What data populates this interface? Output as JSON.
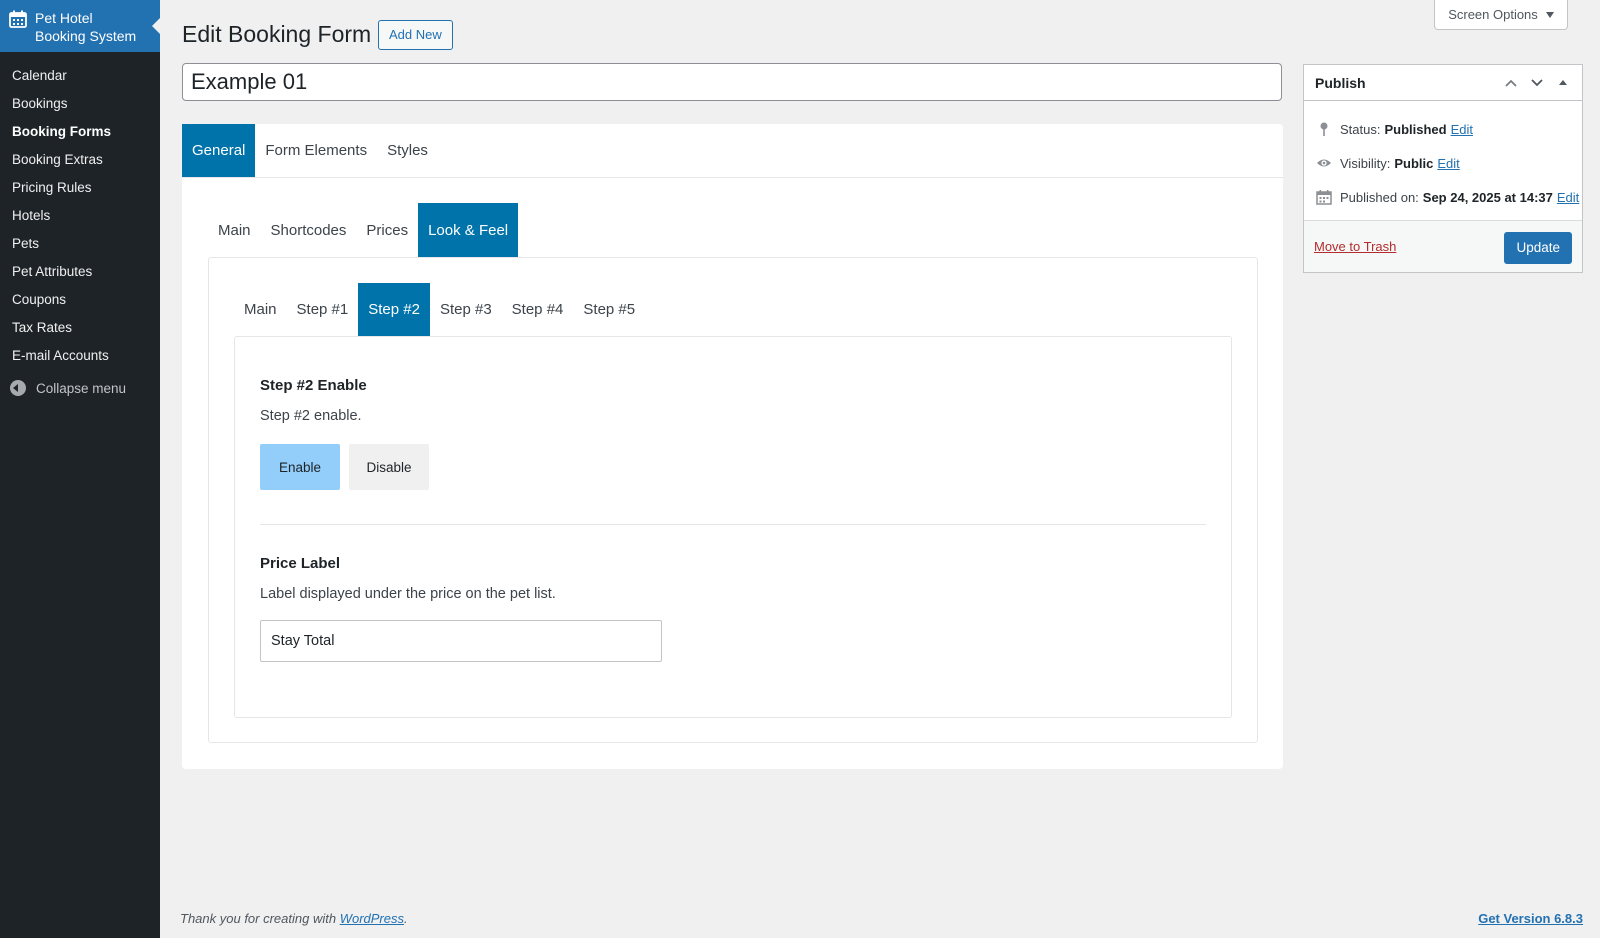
{
  "brand": {
    "name_line1": "Pet Hotel",
    "name_line2": "Booking System"
  },
  "sidebar": {
    "items": [
      {
        "label": "Calendar"
      },
      {
        "label": "Bookings"
      },
      {
        "label": "Booking Forms"
      },
      {
        "label": "Booking Extras"
      },
      {
        "label": "Pricing Rules"
      },
      {
        "label": "Hotels"
      },
      {
        "label": "Pets"
      },
      {
        "label": "Pet Attributes"
      },
      {
        "label": "Coupons"
      },
      {
        "label": "Tax Rates"
      },
      {
        "label": "E-mail Accounts"
      }
    ],
    "current": "Booking Forms",
    "collapse_label": "Collapse menu"
  },
  "header": {
    "screen_options": "Screen Options",
    "title": "Edit Booking Form",
    "add_new": "Add New"
  },
  "post_title": "Example 01",
  "tabs_level1": [
    "General",
    "Form Elements",
    "Styles"
  ],
  "tabs_level2": [
    "Main",
    "Shortcodes",
    "Prices",
    "Look & Feel"
  ],
  "tabs_level3": [
    "Main",
    "Step #1",
    "Step #2",
    "Step #3",
    "Step #4",
    "Step #5"
  ],
  "active_tabs": {
    "level1": "General",
    "level2": "Look & Feel",
    "level3": "Step #2"
  },
  "step2": {
    "title": "Step #2 Enable",
    "description": "Step #2 enable.",
    "enable_label": "Enable",
    "disable_label": "Disable",
    "selected": "Enable"
  },
  "price_label": {
    "title": "Price Label",
    "description": "Label displayed under the price on the pet list.",
    "value": "Stay Total"
  },
  "publish": {
    "title": "Publish",
    "status_label": "Status:",
    "status_value": "Published",
    "visibility_label": "Visibility:",
    "visibility_value": "Public",
    "published_label": "Published on:",
    "published_value": "Sep 24, 2025 at 14:37",
    "edit_label": "Edit",
    "trash_label": "Move to Trash",
    "update_label": "Update"
  },
  "footer": {
    "thanks_prefix": "Thank you for creating with",
    "wordpress_link": "WordPress",
    "thanks_suffix": ".",
    "version": "Get Version 6.8.3"
  },
  "colors": {
    "accent": "#2271b1",
    "tab_active": "#0073aa",
    "sidebar_bg": "#1d2327",
    "toggle_on": "#93cdfa",
    "trash": "#b32d2e"
  }
}
